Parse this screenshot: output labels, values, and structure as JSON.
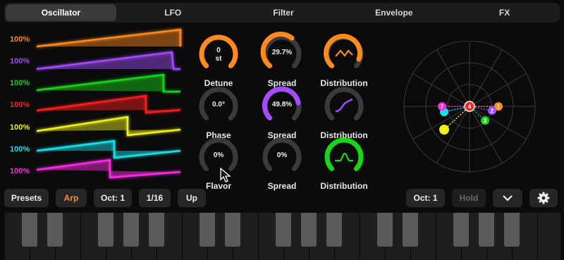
{
  "tabs": [
    {
      "label": "Oscillator",
      "active": true
    },
    {
      "label": "LFO",
      "active": false
    },
    {
      "label": "Filter",
      "active": false
    },
    {
      "label": "Envelope",
      "active": false
    },
    {
      "label": "FX",
      "active": false
    }
  ],
  "waves": [
    {
      "label": "100%",
      "color": "#ff8a1e"
    },
    {
      "label": "100%",
      "color": "#a54bff"
    },
    {
      "label": "100%",
      "color": "#19d419"
    },
    {
      "label": "100%",
      "color": "#ff1e1e"
    },
    {
      "label": "100%",
      "color": "#f0f01a"
    },
    {
      "label": "100%",
      "color": "#18e0e8"
    },
    {
      "label": "100%",
      "color": "#ff2ae6"
    }
  ],
  "knobs": [
    {
      "value": "0",
      "unit": "st",
      "label": "Detune",
      "color": "#ff8a1e",
      "fill": 0.5
    },
    {
      "value": "29.7%",
      "unit": "",
      "label": "Spread",
      "color": "#ff8a1e",
      "fill": 0.3
    },
    {
      "value": "",
      "unit": "",
      "label": "Distribution",
      "color": "#ff8a1e",
      "fill": 0.5,
      "icon": "zigzag"
    },
    {
      "value": "0.0°",
      "unit": "",
      "label": "Phase",
      "color": "#a54bff",
      "fill": 0.0
    },
    {
      "value": "49.8%",
      "unit": "",
      "label": "Spread",
      "color": "#a54bff",
      "fill": 0.5
    },
    {
      "value": "",
      "unit": "",
      "label": "Distribution",
      "color": "#a54bff",
      "fill": 0.0,
      "icon": "scurve"
    },
    {
      "value": "0%",
      "unit": "",
      "label": "Flavor",
      "color": "#19d419",
      "fill": 0.0
    },
    {
      "value": "0%",
      "unit": "",
      "label": "Spread",
      "color": "#19d419",
      "fill": 0.0
    },
    {
      "value": "",
      "unit": "",
      "label": "Distribution",
      "color": "#19d419",
      "fill": 1.0,
      "icon": "bump"
    }
  ],
  "polar_nodes": [
    {
      "label": "4",
      "color": "#ff1e1e"
    },
    {
      "label": "1",
      "color": "#ff8a1e"
    },
    {
      "label": "2",
      "color": "#a54bff"
    },
    {
      "label": "3",
      "color": "#19d419"
    },
    {
      "label": "7",
      "color": "#ff2ae6"
    },
    {
      "label": "",
      "color": "#18e0e8"
    },
    {
      "label": "",
      "color": "#f0f01a"
    }
  ],
  "bottom": {
    "presets": "Presets",
    "arp": "Arp",
    "oct_left": "Oct: 1",
    "rate": "1/16",
    "direction": "Up",
    "oct_right": "Oct: 1",
    "hold": "Hold",
    "chevron_icon": "chevron-down-icon",
    "settings_icon": "gear-icon"
  }
}
